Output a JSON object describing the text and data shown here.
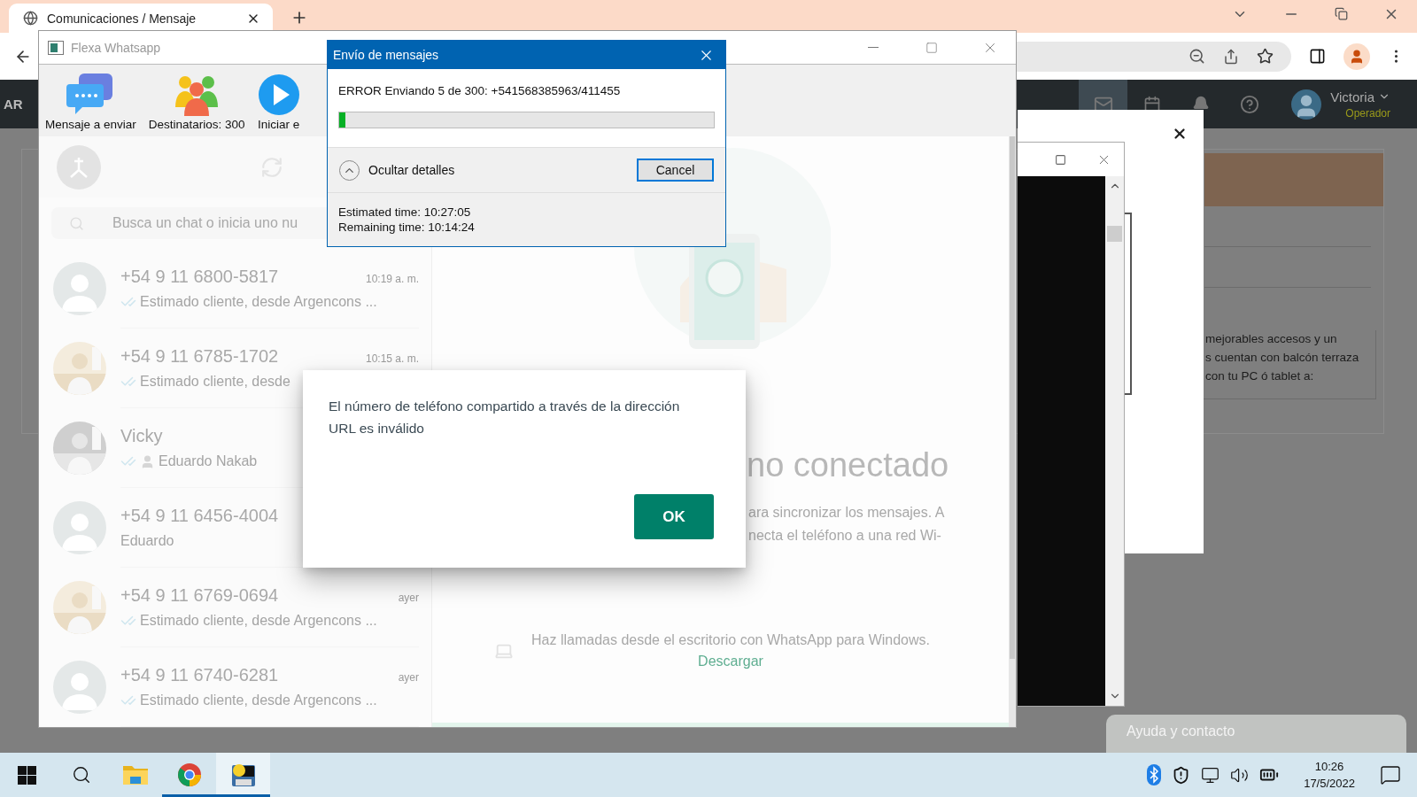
{
  "browser": {
    "tab": {
      "title": "Comunicaciones / Mensaje"
    }
  },
  "web_header": {
    "logo_text": "AR",
    "nav": [
      {
        "kind": "mail",
        "selected": true
      },
      {
        "kind": "calendar",
        "selected": false
      },
      {
        "kind": "bell",
        "selected": false
      },
      {
        "kind": "help",
        "selected": false
      }
    ],
    "user": {
      "name": "Victoria",
      "role": "Operador"
    }
  },
  "web_page": {
    "text_lines": [
      "mejorables accesos y un",
      "s cuentan con balcón terraza",
      "con tu PC ó tablet a:"
    ]
  },
  "help_button": {
    "label": "Ayuda y contacto"
  },
  "app_window": {
    "title": "Flexa Whatsapp",
    "toolbar": [
      {
        "kind": "message",
        "label": "Mensaje a enviar"
      },
      {
        "kind": "recipients",
        "label": "Destinatarios: 300"
      },
      {
        "kind": "start",
        "label": "Iniciar e"
      }
    ],
    "search": {
      "placeholder": "Busca un chat o inicia uno nu"
    },
    "chats": [
      {
        "kind": "plain",
        "name": "+54 9 11 6800-5817",
        "time": "10:19 a. m.",
        "ticks": true,
        "contact_icon": false,
        "preview": "Estimado cliente, desde Argencons ..."
      },
      {
        "name": "+54 9 11 6785-1702",
        "time": "10:15 a. m.",
        "ticks": true,
        "contact_icon": false,
        "preview": "Estimado cliente, desde"
      },
      {
        "name": "Vicky",
        "ticks": true,
        "contact_icon": true,
        "preview": "Eduardo Nakab"
      },
      {
        "kind": "plain",
        "name": "+54 9 11 6456-4004",
        "ticks": false,
        "contact_icon": false,
        "preview": "Eduardo"
      },
      {
        "name": "+54 9 11 6769-0694",
        "time": "ayer",
        "ticks": true,
        "contact_icon": false,
        "preview": "Estimado cliente, desde Argencons ..."
      },
      {
        "kind": "plain",
        "name": "+54 9 11 6740-6281",
        "time": "ayer",
        "ticks": true,
        "contact_icon": false,
        "preview": "Estimado cliente, desde Argencons ..."
      }
    ],
    "main": {
      "heading": "no conectado",
      "lines": [
        "ara sincronizar los mensajes. A",
        "necta el teléfono a una red Wi-"
      ],
      "footer": "Haz llamadas desde el escritorio con WhatsApp para Windows.",
      "link": "Descargar"
    }
  },
  "send_dialog": {
    "title": "Envío de mensajes",
    "status": "ERROR Enviando 5 de 300: +541568385963/411455",
    "level": 0.017,
    "toggle": "Ocultar detalles",
    "cancel": "Cancel",
    "details": [
      "Estimated time: 10:27:05",
      "Remaining time: 10:14:24"
    ]
  },
  "alert": {
    "message": "El número de teléfono compartido a través de la dirección URL es inválido",
    "button": "OK"
  },
  "taskbar": {
    "items": [
      {
        "kind": "start",
        "running": false,
        "selected": false
      },
      {
        "kind": "search",
        "running": false,
        "selected": false
      },
      {
        "kind": "explorer",
        "running": false,
        "selected": false
      },
      {
        "kind": "chrome",
        "running": true,
        "selected": false
      },
      {
        "kind": "app",
        "running": true,
        "selected": true
      }
    ],
    "clock": {
      "time": "10:26",
      "date": "17/5/2022"
    }
  }
}
